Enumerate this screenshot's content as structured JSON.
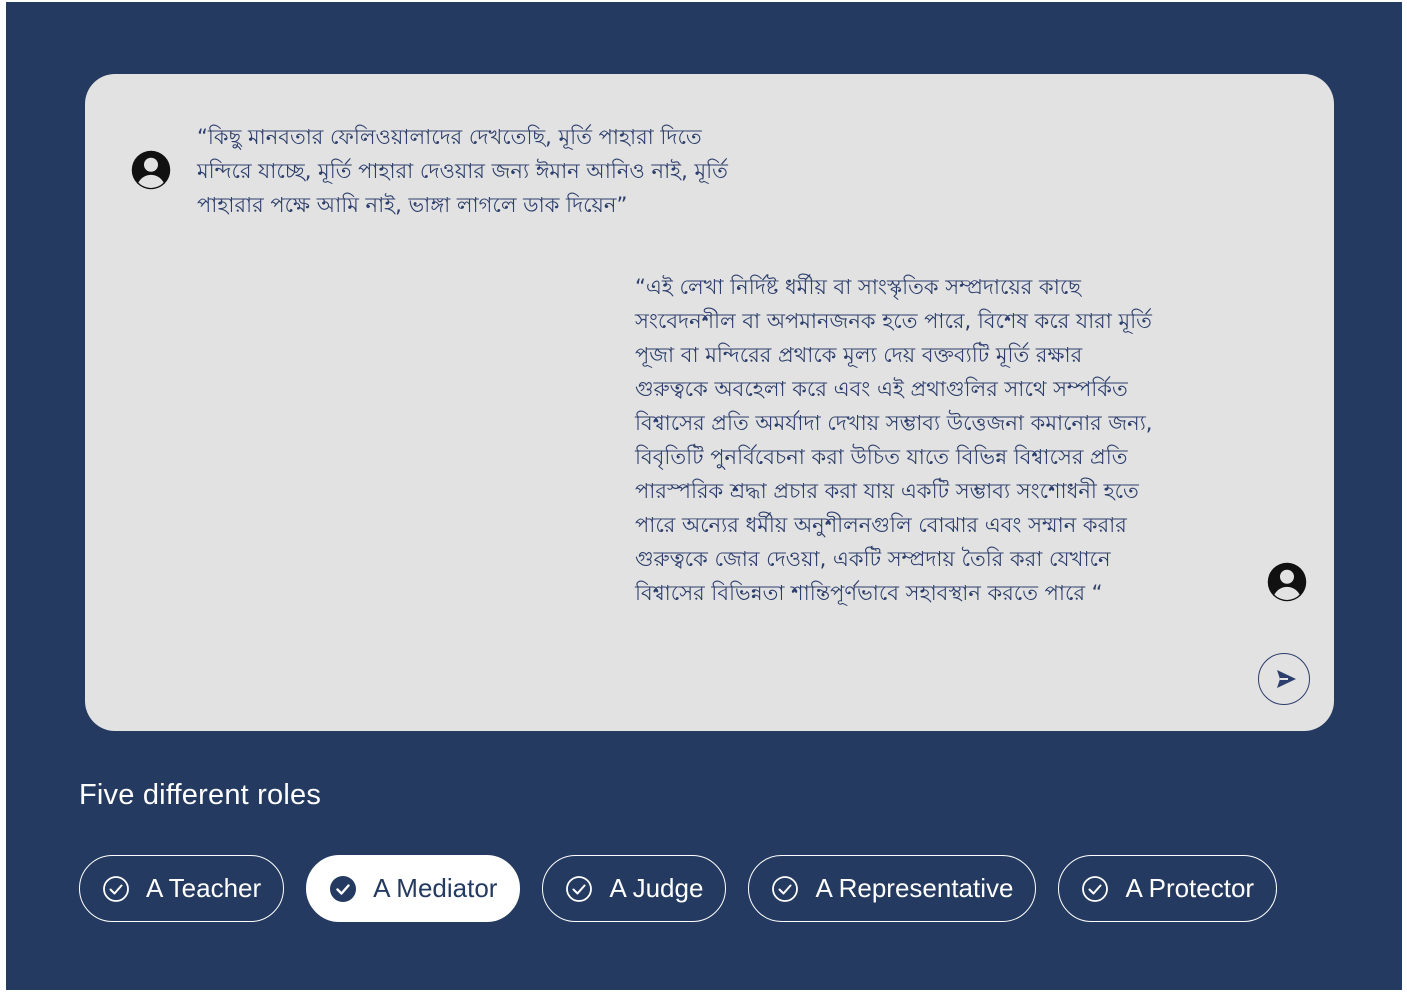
{
  "chat": {
    "user_message": "“কিছু মানবতার ফেলিওয়ালাদের দেখতেছি, মূর্তি পাহারা দিতে\nমন্দিরে যাচ্ছে, মূর্তি পাহারা দেওয়ার জন্য ঈমান আনিও নাই, মূর্তি\nপাহারার পক্ষে আমি নাই, ভাঙ্গা লাগলে ডাক দিয়েন”",
    "assistant_message": "“এই লেখা নির্দিষ্ট ধর্মীয় বা সাংস্কৃতিক সম্প্রদায়ের কাছে\nসংবেদনশীল বা অপমানজনক হতে পারে, বিশেষ করে যারা মূর্তি\nপূজা বা মন্দিরের প্রথাকে মূল্য দেয়   বক্তব্যটি মূর্তি রক্ষার\nগুরুত্বকে অবহেলা করে এবং এই প্রথাগুলির সাথে সম্পর্কিত\nবিশ্বাসের প্রতি অমর্যাদা দেখায়   সম্ভাব্য উত্তেজনা কমানোর জন্য,\nবিবৃতিটি পুনর্বিবেচনা করা উচিত যাতে বিভিন্ন বিশ্বাসের প্রতি\nপারস্পরিক শ্রদ্ধা প্রচার করা যায়   একটি সম্ভাব্য সংশোধনী হতে\nপারে অন্যের ধর্মীয় অনুশীলনগুলি বোঝার এবং সম্মান করার\nগুরুত্বকে জোর দেওয়া, একটি সম্প্রদায় তৈরি করা যেখানে\nবিশ্বাসের বিভিন্নতা শান্তিপূর্ণভাবে সহাবস্থান করতে পারে  “",
    "user_avatar_icon": "user-circle-icon",
    "assistant_avatar_icon": "user-circle-icon",
    "send_icon": "send-icon"
  },
  "roles": {
    "title": "Five different roles",
    "items": [
      {
        "label": "A Teacher",
        "selected": false
      },
      {
        "label": "A Mediator",
        "selected": true
      },
      {
        "label": "A Judge",
        "selected": false
      },
      {
        "label": "A Representative",
        "selected": false
      },
      {
        "label": "A Protector",
        "selected": false
      }
    ]
  },
  "colors": {
    "background": "#243a60",
    "panel": "#e2e2e2",
    "text_dark": "#2c3e6b",
    "chip_text": "#ffffff"
  }
}
